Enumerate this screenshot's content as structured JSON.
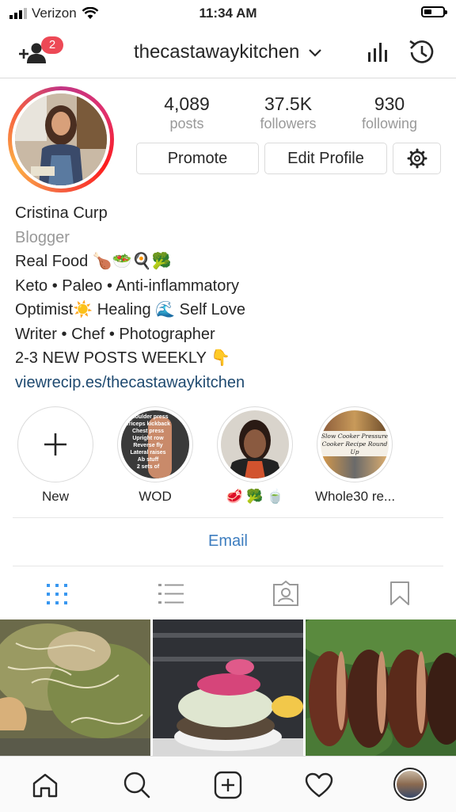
{
  "status_bar": {
    "carrier": "Verizon",
    "time": "11:34 AM"
  },
  "nav": {
    "username": "thecastawaykitchen",
    "notification_count": "2"
  },
  "stats": [
    {
      "value": "4,089",
      "label": "posts"
    },
    {
      "value": "37.5K",
      "label": "followers"
    },
    {
      "value": "930",
      "label": "following"
    }
  ],
  "buttons": {
    "promote": "Promote",
    "edit_profile": "Edit Profile"
  },
  "bio": {
    "name": "Cristina Curp",
    "category": "Blogger",
    "lines": [
      "Real Food 🍗🥗🍳🥦",
      "Keto • Paleo • Anti-inflammatory",
      "Optimist☀️ Healing 🌊 Self Love",
      "Writer • Chef • Photographer",
      "2-3 NEW POSTS WEEKLY 👇"
    ],
    "website": "viewrecip.es/thecastawaykitchen"
  },
  "highlights": [
    {
      "label": "New",
      "icon": "plus-icon"
    },
    {
      "label": "WOD"
    },
    {
      "label": "🥩 🥦 🍵"
    },
    {
      "label": "Whole30 re..."
    }
  ],
  "highlight_texts": {
    "wod": [
      "Shoulder press",
      "Triceps kickback",
      "Chest press",
      "Upright row",
      "Reverse fly",
      "Lateral raises",
      "Ab stuff",
      "2 sets of"
    ],
    "whole30": [
      "Slow Cooker Pressure",
      "Cooker Recipe Round Up"
    ]
  },
  "email_label": "Email",
  "tabs": [
    "grid-icon",
    "list-icon",
    "tagged-icon",
    "saved-icon"
  ],
  "bottom_nav": [
    "home-icon",
    "search-icon",
    "add-post-icon",
    "heart-icon",
    "profile-avatar"
  ],
  "colors": {
    "link": "#1f4a70",
    "email": "#3d7dbf",
    "active_tab": "#3897f0",
    "badge": "#ed4956"
  }
}
